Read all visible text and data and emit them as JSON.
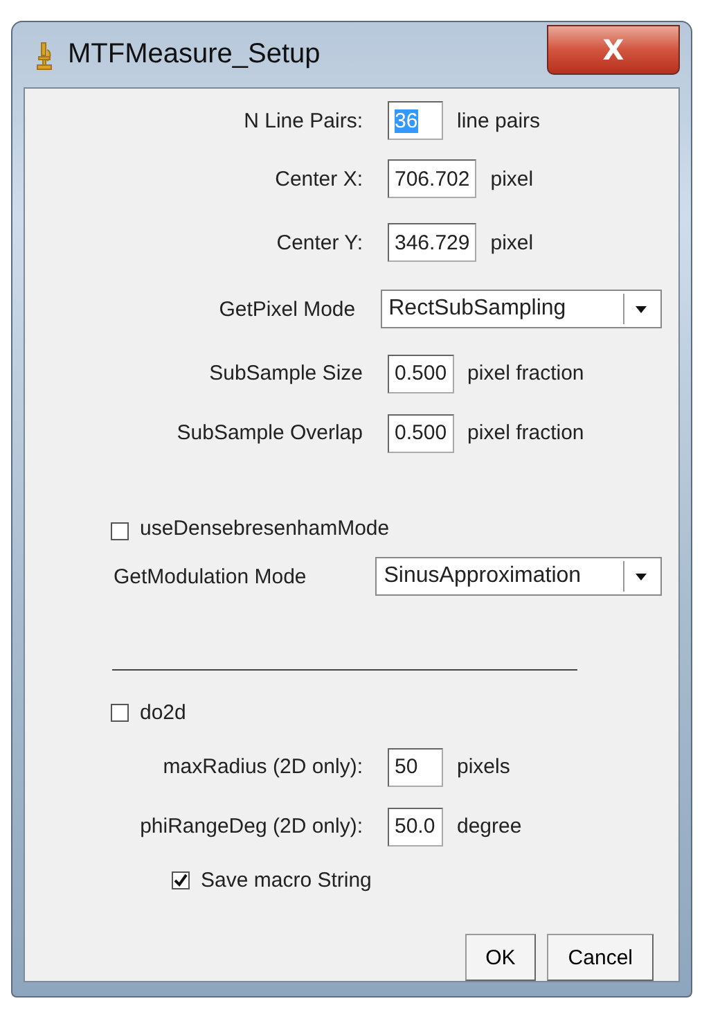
{
  "window": {
    "title": "MTFMeasure_Setup",
    "close_label": "X"
  },
  "rows": [
    {
      "kind": "field",
      "label": "N Line Pairs:",
      "value": "36",
      "unit": "line pairs",
      "highlighted": true
    },
    {
      "kind": "field",
      "label": "Center X:",
      "value": "706.702",
      "unit": "pixel",
      "highlighted": false
    },
    {
      "kind": "field",
      "label": "Center Y:",
      "value": "346.729",
      "unit": "pixel",
      "highlighted": false
    },
    {
      "kind": "choice",
      "label": "GetPixel Mode",
      "value": "RectSubSampling"
    },
    {
      "kind": "field",
      "label": "SubSample Size",
      "value": "0.500",
      "unit": "pixel fraction",
      "highlighted": false
    },
    {
      "kind": "field",
      "label": "SubSample Overlap",
      "value": "0.500",
      "unit": "pixel fraction",
      "highlighted": false
    },
    {
      "kind": "check",
      "label": "useDensebresenhamMode",
      "checked": false
    },
    {
      "kind": "choice_left",
      "label": "GetModulation Mode",
      "value": "SinusApproximation"
    },
    {
      "kind": "separator"
    },
    {
      "kind": "check",
      "label": "do2d",
      "checked": false
    },
    {
      "kind": "field",
      "label": "maxRadius (2D only):",
      "value": "50",
      "unit": "pixels",
      "highlighted": false
    },
    {
      "kind": "field",
      "label": "phiRangeDeg (2D only):",
      "value": "50.0",
      "unit": "degree",
      "highlighted": false
    },
    {
      "kind": "check_inset",
      "label": "Save macro String",
      "checked": true
    }
  ],
  "buttons": [
    "OK",
    "Cancel"
  ]
}
